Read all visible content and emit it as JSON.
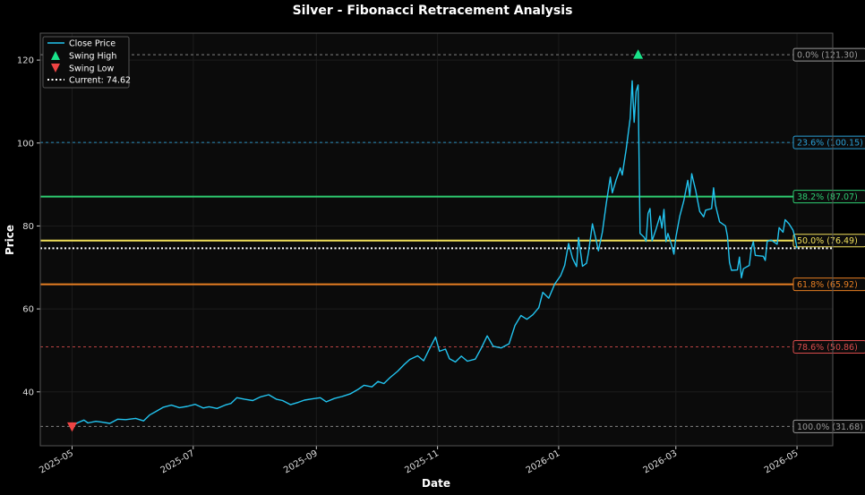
{
  "chart_data": {
    "type": "line",
    "title": "Silver - Fibonacci Retracement Analysis",
    "xlabel": "Date",
    "ylabel": "Price",
    "xlim": [
      "2025-04-15",
      "2026-05-19"
    ],
    "ylim": [
      27,
      126.5
    ],
    "grid": true,
    "legend_position": "top-left",
    "x_ticks": [
      "2025-05",
      "2025-07",
      "2025-09",
      "2025-11",
      "2026-01",
      "2026-03",
      "2026-05"
    ],
    "y_ticks": [
      40,
      60,
      80,
      100,
      120
    ],
    "colors": {
      "background": "#0b0b0b",
      "close": "#22c4f0",
      "swing_high": "#19e38a",
      "swing_low": "#ee4444",
      "current": "#ffffff"
    },
    "close_series": {
      "name": "Close Price",
      "points": [
        [
          "2025-05-01",
          31.8
        ],
        [
          "2025-05-04",
          32.6
        ],
        [
          "2025-05-07",
          33.2
        ],
        [
          "2025-05-09",
          32.5
        ],
        [
          "2025-05-13",
          32.9
        ],
        [
          "2025-05-16",
          32.7
        ],
        [
          "2025-05-20",
          32.4
        ],
        [
          "2025-05-24",
          33.4
        ],
        [
          "2025-05-28",
          33.3
        ],
        [
          "2025-06-02",
          33.6
        ],
        [
          "2025-06-06",
          33.0
        ],
        [
          "2025-06-09",
          34.4
        ],
        [
          "2025-06-12",
          35.2
        ],
        [
          "2025-06-16",
          36.3
        ],
        [
          "2025-06-20",
          36.8
        ],
        [
          "2025-06-24",
          36.2
        ],
        [
          "2025-06-28",
          36.5
        ],
        [
          "2025-07-02",
          37.0
        ],
        [
          "2025-07-06",
          36.1
        ],
        [
          "2025-07-09",
          36.4
        ],
        [
          "2025-07-13",
          36.0
        ],
        [
          "2025-07-17",
          36.8
        ],
        [
          "2025-07-20",
          37.2
        ],
        [
          "2025-07-23",
          38.6
        ],
        [
          "2025-07-27",
          38.2
        ],
        [
          "2025-07-31",
          37.9
        ],
        [
          "2025-08-04",
          38.8
        ],
        [
          "2025-08-08",
          39.3
        ],
        [
          "2025-08-12",
          38.2
        ],
        [
          "2025-08-15",
          37.9
        ],
        [
          "2025-08-19",
          36.9
        ],
        [
          "2025-08-23",
          37.5
        ],
        [
          "2025-08-26",
          38.0
        ],
        [
          "2025-08-30",
          38.3
        ],
        [
          "2025-09-03",
          38.6
        ],
        [
          "2025-09-06",
          37.6
        ],
        [
          "2025-09-10",
          38.4
        ],
        [
          "2025-09-14",
          38.9
        ],
        [
          "2025-09-18",
          39.5
        ],
        [
          "2025-09-22",
          40.6
        ],
        [
          "2025-09-25",
          41.6
        ],
        [
          "2025-09-29",
          41.2
        ],
        [
          "2025-10-02",
          42.5
        ],
        [
          "2025-10-05",
          42.0
        ],
        [
          "2025-10-08",
          43.4
        ],
        [
          "2025-10-12",
          45.0
        ],
        [
          "2025-10-15",
          46.5
        ],
        [
          "2025-10-18",
          47.8
        ],
        [
          "2025-10-22",
          48.7
        ],
        [
          "2025-10-25",
          47.5
        ],
        [
          "2025-10-28",
          50.4
        ],
        [
          "2025-10-31",
          53.2
        ],
        [
          "2025-11-02",
          49.8
        ],
        [
          "2025-11-05",
          50.3
        ],
        [
          "2025-11-07",
          48.0
        ],
        [
          "2025-11-10",
          47.2
        ],
        [
          "2025-11-13",
          48.6
        ],
        [
          "2025-11-16",
          47.4
        ],
        [
          "2025-11-20",
          47.9
        ],
        [
          "2025-11-23",
          50.5
        ],
        [
          "2025-11-26",
          53.5
        ],
        [
          "2025-11-29",
          51.0
        ],
        [
          "2025-12-03",
          50.6
        ],
        [
          "2025-12-07",
          51.6
        ],
        [
          "2025-12-10",
          56.0
        ],
        [
          "2025-12-13",
          58.4
        ],
        [
          "2025-12-16",
          57.5
        ],
        [
          "2025-12-19",
          58.6
        ],
        [
          "2025-12-22",
          60.3
        ],
        [
          "2025-12-24",
          64.0
        ],
        [
          "2025-12-27",
          62.6
        ],
        [
          "2025-12-30",
          66.0
        ],
        [
          "2026-01-02",
          68.0
        ],
        [
          "2026-01-04",
          70.5
        ],
        [
          "2026-01-06",
          75.8
        ],
        [
          "2026-01-08",
          72.2
        ],
        [
          "2026-01-10",
          70.2
        ],
        [
          "2026-01-11",
          77.2
        ],
        [
          "2026-01-13",
          70.3
        ],
        [
          "2026-01-15",
          71.0
        ],
        [
          "2026-01-16",
          73.6
        ],
        [
          "2026-01-18",
          80.5
        ],
        [
          "2026-01-20",
          76.3
        ],
        [
          "2026-01-21",
          74.0
        ],
        [
          "2026-01-23",
          78.5
        ],
        [
          "2026-01-25",
          85.5
        ],
        [
          "2026-01-27",
          91.8
        ],
        [
          "2026-01-28",
          88.0
        ],
        [
          "2026-01-30",
          91.2
        ],
        [
          "2026-02-01",
          94.0
        ],
        [
          "2026-02-02",
          92.3
        ],
        [
          "2026-02-04",
          98.5
        ],
        [
          "2026-02-06",
          106.0
        ],
        [
          "2026-02-07",
          115.0
        ],
        [
          "2026-02-08",
          105.0
        ],
        [
          "2026-02-09",
          112.5
        ],
        [
          "2026-02-10",
          114.0
        ],
        [
          "2026-02-11",
          78.2
        ],
        [
          "2026-02-13",
          77.3
        ],
        [
          "2026-02-14",
          76.3
        ],
        [
          "2026-02-15",
          83.0
        ],
        [
          "2026-02-16",
          84.2
        ],
        [
          "2026-02-17",
          76.4
        ],
        [
          "2026-02-19",
          79.2
        ],
        [
          "2026-02-21",
          82.4
        ],
        [
          "2026-02-22",
          79.5
        ],
        [
          "2026-02-23",
          84.0
        ],
        [
          "2026-02-24",
          76.2
        ],
        [
          "2026-02-25",
          78.2
        ],
        [
          "2026-02-27",
          75.2
        ],
        [
          "2026-02-28",
          73.2
        ],
        [
          "2026-03-01",
          77.3
        ],
        [
          "2026-03-03",
          82.4
        ],
        [
          "2026-03-05",
          86.0
        ],
        [
          "2026-03-07",
          91.0
        ],
        [
          "2026-03-08",
          87.2
        ],
        [
          "2026-03-09",
          92.6
        ],
        [
          "2026-03-11",
          88.5
        ],
        [
          "2026-03-13",
          83.5
        ],
        [
          "2026-03-15",
          82.2
        ],
        [
          "2026-03-16",
          83.8
        ],
        [
          "2026-03-19",
          84.2
        ],
        [
          "2026-03-20",
          89.2
        ],
        [
          "2026-03-21",
          85.0
        ],
        [
          "2026-03-23",
          81.0
        ],
        [
          "2026-03-26",
          80.0
        ],
        [
          "2026-03-27",
          77.5
        ],
        [
          "2026-03-28",
          71.2
        ],
        [
          "2026-03-29",
          69.3
        ],
        [
          "2026-04-01",
          69.4
        ],
        [
          "2026-04-02",
          72.5
        ],
        [
          "2026-04-03",
          67.5
        ],
        [
          "2026-04-04",
          69.7
        ],
        [
          "2026-04-07",
          70.5
        ],
        [
          "2026-04-08",
          74.6
        ],
        [
          "2026-04-09",
          76.2
        ],
        [
          "2026-04-10",
          72.9
        ],
        [
          "2026-04-14",
          72.7
        ],
        [
          "2026-04-15",
          71.7
        ],
        [
          "2026-04-16",
          76.3
        ],
        [
          "2026-04-18",
          76.6
        ],
        [
          "2026-04-21",
          75.6
        ],
        [
          "2026-04-22",
          79.6
        ],
        [
          "2026-04-24",
          78.5
        ],
        [
          "2026-04-25",
          81.5
        ],
        [
          "2026-04-27",
          80.5
        ],
        [
          "2026-04-29",
          79.0
        ],
        [
          "2026-04-30",
          77.2
        ],
        [
          "2026-05-01",
          74.6
        ]
      ]
    },
    "swing_high": {
      "name": "Swing High",
      "date": "2026-02-10",
      "value": 121.3
    },
    "swing_low": {
      "name": "Swing Low",
      "date": "2025-05-01",
      "value": 31.68
    },
    "current": {
      "name": "Current: 74.62",
      "value": 74.62
    },
    "fib_levels": [
      {
        "label": "0.0% (121.30)",
        "value": 121.3,
        "color": "#999999",
        "style": "dashed"
      },
      {
        "label": "23.6% (100.15)",
        "value": 100.15,
        "color": "#2a9fd6",
        "style": "dashed"
      },
      {
        "label": "38.2% (87.07)",
        "value": 87.07,
        "color": "#2ecc71",
        "style": "solid"
      },
      {
        "label": "50.0% (76.49)",
        "value": 76.49,
        "color": "#f1e05a",
        "style": "solid"
      },
      {
        "label": "61.8% (65.92)",
        "value": 65.92,
        "color": "#e67e22",
        "style": "solid"
      },
      {
        "label": "78.6% (50.86)",
        "value": 50.86,
        "color": "#d94c4c",
        "style": "dashed"
      },
      {
        "label": "100.0% (31.68)",
        "value": 31.68,
        "color": "#999999",
        "style": "dashed"
      }
    ]
  }
}
